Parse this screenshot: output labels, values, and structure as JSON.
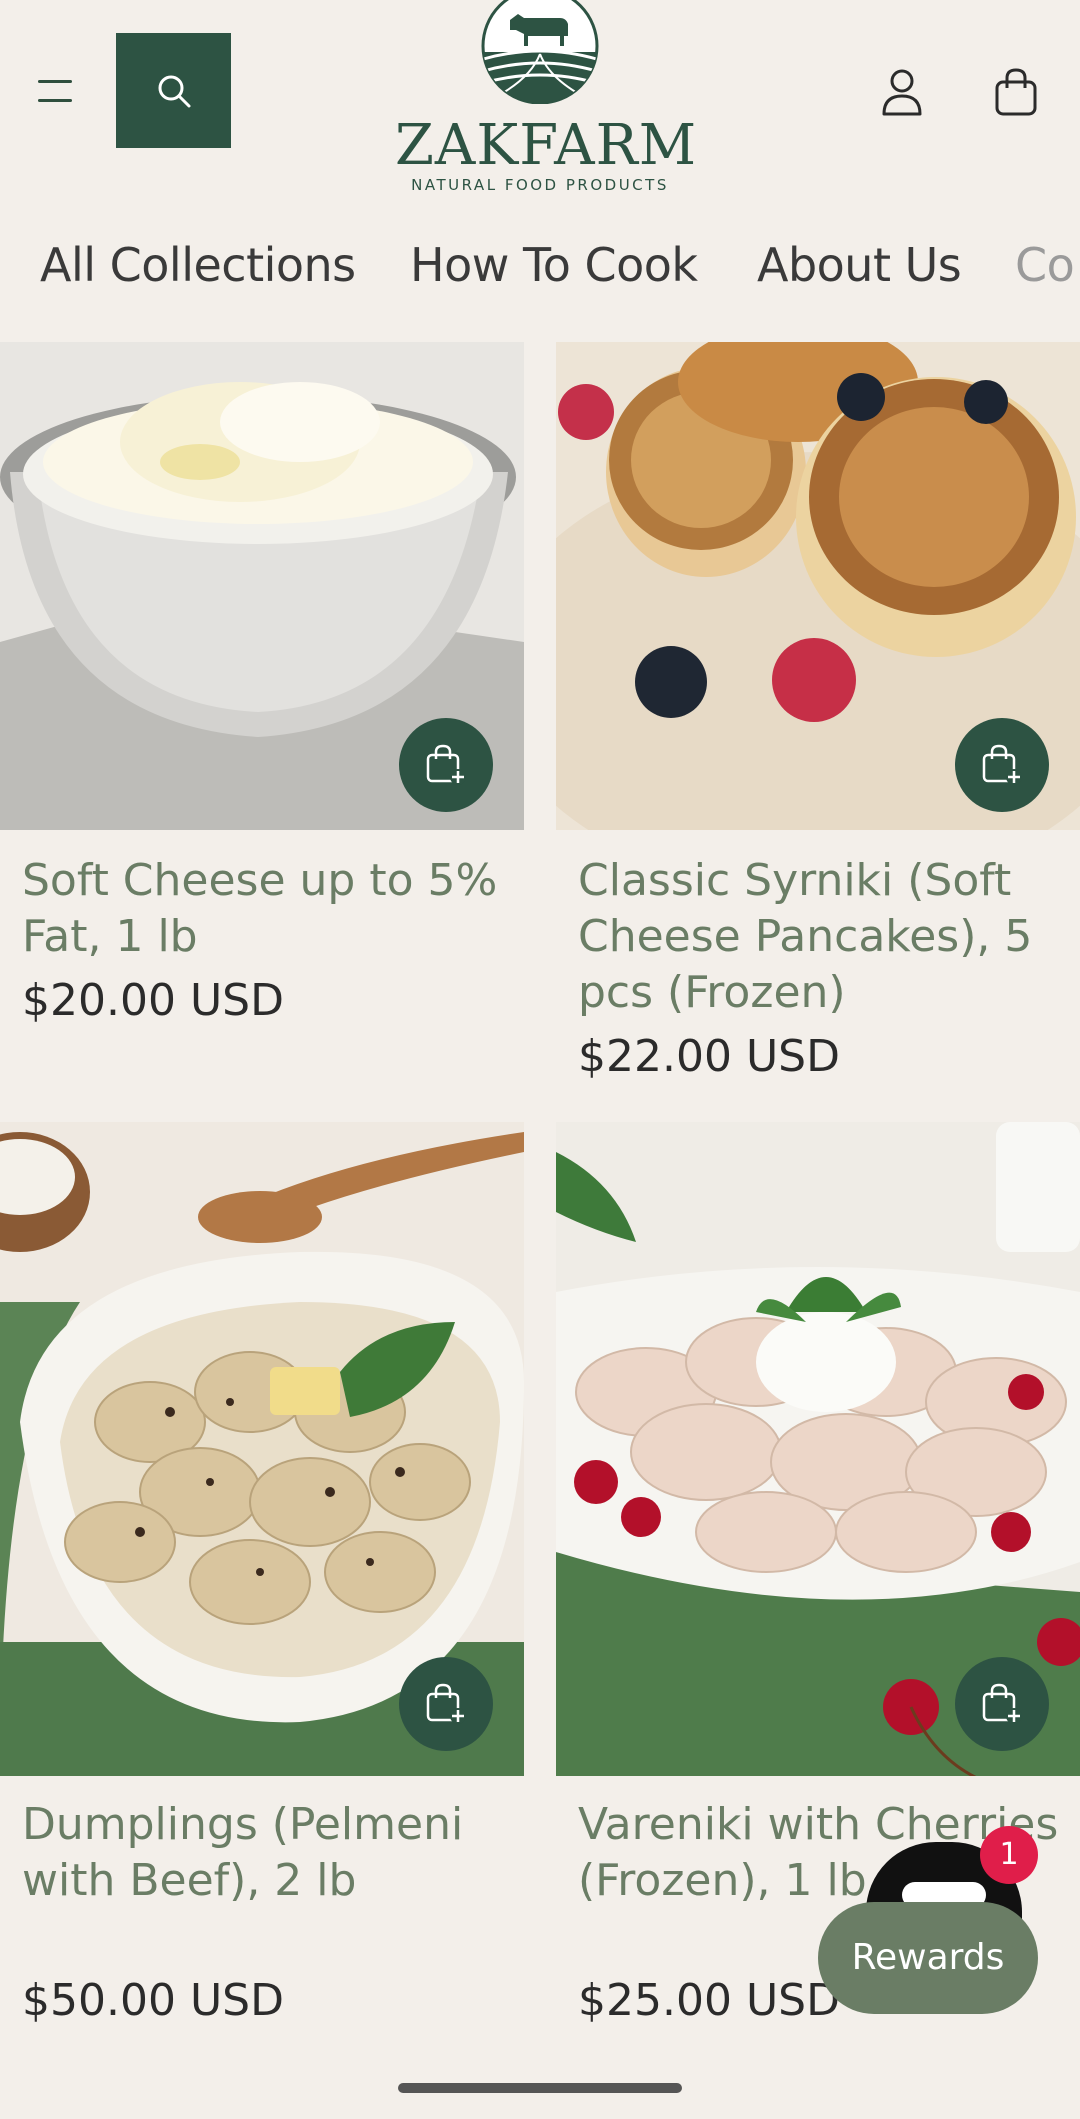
{
  "brand": {
    "name": "ZAKFARM",
    "tagline": "NATURAL FOOD PRODUCTS",
    "accent_color": "#2d5343",
    "title_color": "#6a7d65"
  },
  "header": {
    "menu_icon": "menu-icon",
    "search_icon": "search-icon",
    "account_icon": "account-icon",
    "bag_icon": "shopping-bag-icon"
  },
  "nav": {
    "items": [
      {
        "label": "All Collections"
      },
      {
        "label": "How To Cook"
      },
      {
        "label": "About Us"
      },
      {
        "label": "Co"
      }
    ]
  },
  "products": [
    {
      "title": "Soft Cheese up to 5% Fat, 1 lb",
      "price": "$20.00 USD",
      "image": "soft-cheese-bowl"
    },
    {
      "title": "Classic Syrniki (Soft Cheese Pancakes), 5 pcs (Frozen)",
      "price": "$22.00 USD",
      "image": "syrniki-plate"
    },
    {
      "title": "Dumplings (Pelmeni with Beef), 2 lb",
      "price": "$50.00 USD",
      "image": "pelmeni-bowl"
    },
    {
      "title": "Vareniki with Cherries (Frozen), 1 lb",
      "price": "$25.00 USD",
      "image": "vareniki-bowl"
    }
  ],
  "add_to_cart_icon": "bag-plus-icon",
  "chat": {
    "badge_count": "1",
    "icon": "chat-icon"
  },
  "rewards": {
    "label": "Rewards"
  }
}
